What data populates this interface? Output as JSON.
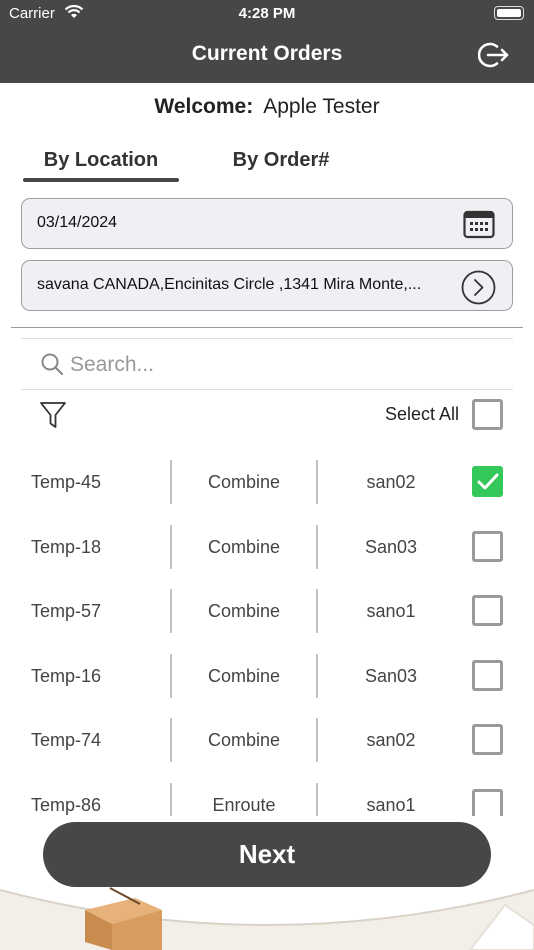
{
  "status": {
    "carrier": "Carrier",
    "time": "4:28 PM"
  },
  "header": {
    "title": "Current Orders"
  },
  "welcome": {
    "label": "Welcome:",
    "name": "Apple Tester"
  },
  "tabs": [
    {
      "label": "By Location",
      "active": true
    },
    {
      "label": "By Order#",
      "active": false
    }
  ],
  "date_field": {
    "value": "03/14/2024"
  },
  "location_field": {
    "value": "savana CANADA,Encinitas Circle ,1341 Mira Monte,..."
  },
  "search": {
    "placeholder": "Search..."
  },
  "select_all": {
    "label": "Select All",
    "checked": false
  },
  "orders": [
    {
      "id": "Temp-45",
      "status": "Combine",
      "location": "san02",
      "checked": true
    },
    {
      "id": "Temp-18",
      "status": "Combine",
      "location": "San03",
      "checked": false
    },
    {
      "id": "Temp-57",
      "status": "Combine",
      "location": "sano1",
      "checked": false
    },
    {
      "id": "Temp-16",
      "status": "Combine",
      "location": "San03",
      "checked": false
    },
    {
      "id": "Temp-74",
      "status": "Combine",
      "location": "san02",
      "checked": false
    },
    {
      "id": "Temp-86",
      "status": "Enroute",
      "location": "sano1",
      "checked": false
    }
  ],
  "next_button": {
    "label": "Next"
  },
  "colors": {
    "header_bg": "#474747",
    "checked_green": "#34c759",
    "field_bg": "#efeff4"
  }
}
